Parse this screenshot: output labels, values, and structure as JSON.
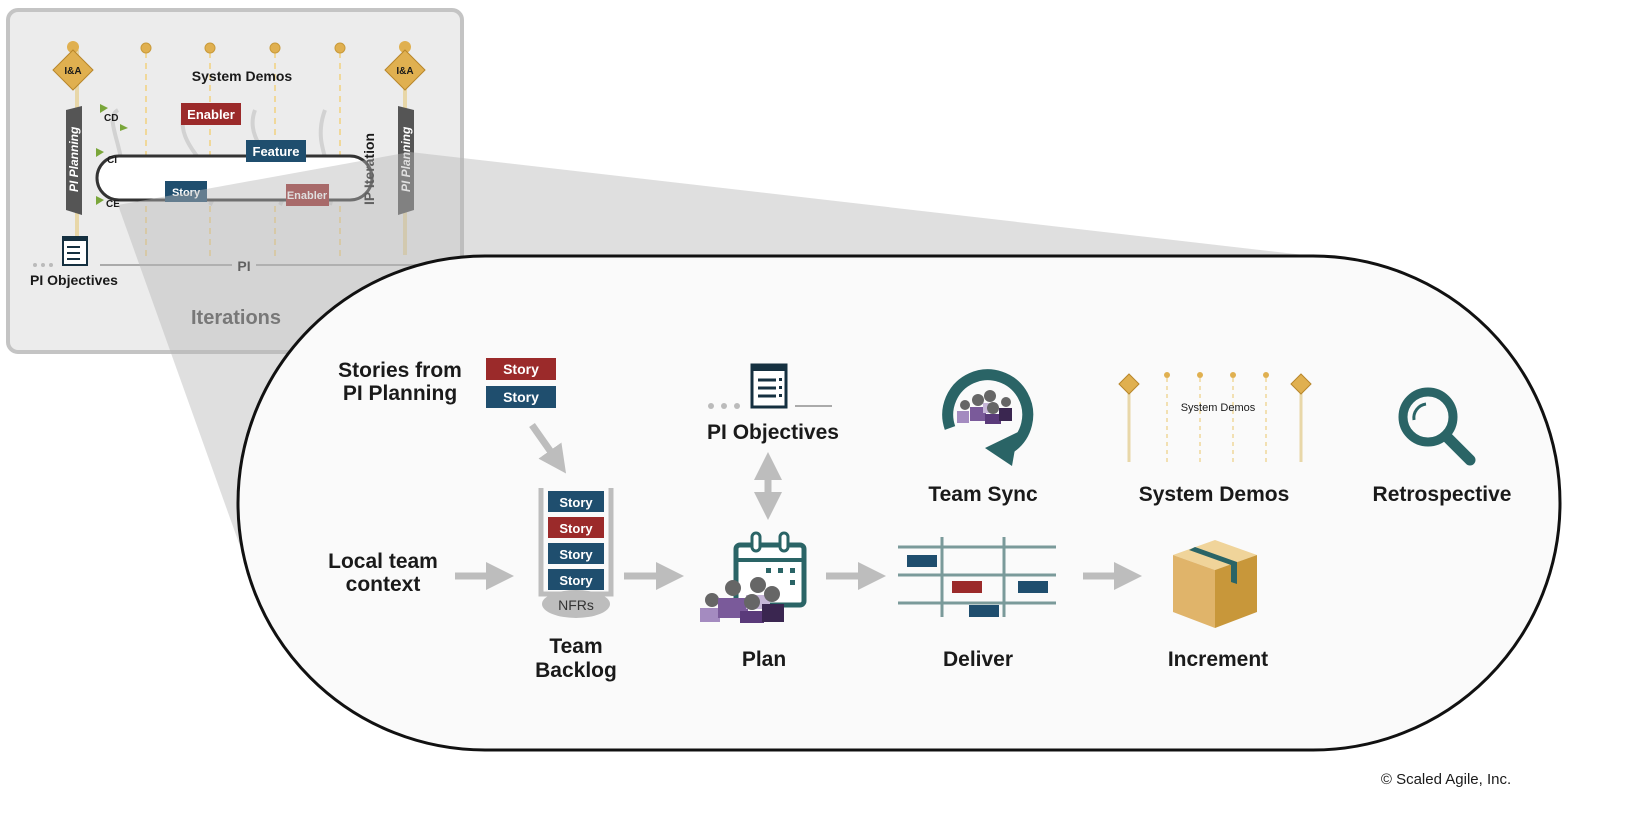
{
  "inset": {
    "system_demos": "System Demos",
    "enabler_top": "Enabler",
    "feature": "Feature",
    "story": "Story",
    "enabler_bottom": "Enabler",
    "ip_iteration": "IP Iteration",
    "pi_planning_left": "PI Planning",
    "pi_planning_right": "PI Planning",
    "ia_badge": "I&A",
    "cd": "CD",
    "ci": "CI",
    "ce": "CE",
    "pi": "PI",
    "pi_objectives": "PI Objectives",
    "iterations": "Iterations"
  },
  "main": {
    "stories_from_line1": "Stories from",
    "stories_from_line2": "PI Planning",
    "incoming_stories": [
      "Story",
      "Story"
    ],
    "local_context_line1": "Local team",
    "local_context_line2": "context",
    "backlog_stories": [
      "Story",
      "Story",
      "Story",
      "Story"
    ],
    "nfrs": "NFRs",
    "team_backlog_line1": "Team",
    "team_backlog_line2": "Backlog",
    "pi_objectives": "PI Objectives",
    "plan": "Plan",
    "deliver": "Deliver",
    "increment": "Increment",
    "team_sync": "Team Sync",
    "system_demos": "System Demos",
    "system_demos_mini": "System Demos",
    "retrospective": "Retrospective"
  },
  "copyright": "© Scaled Agile, Inc.",
  "colors": {
    "story_red": "#9b2a2a",
    "story_blue": "#1f4e6e",
    "teal": "#2a6466",
    "gold": "#e0b050",
    "arrow_gray": "#bdbdbd"
  }
}
